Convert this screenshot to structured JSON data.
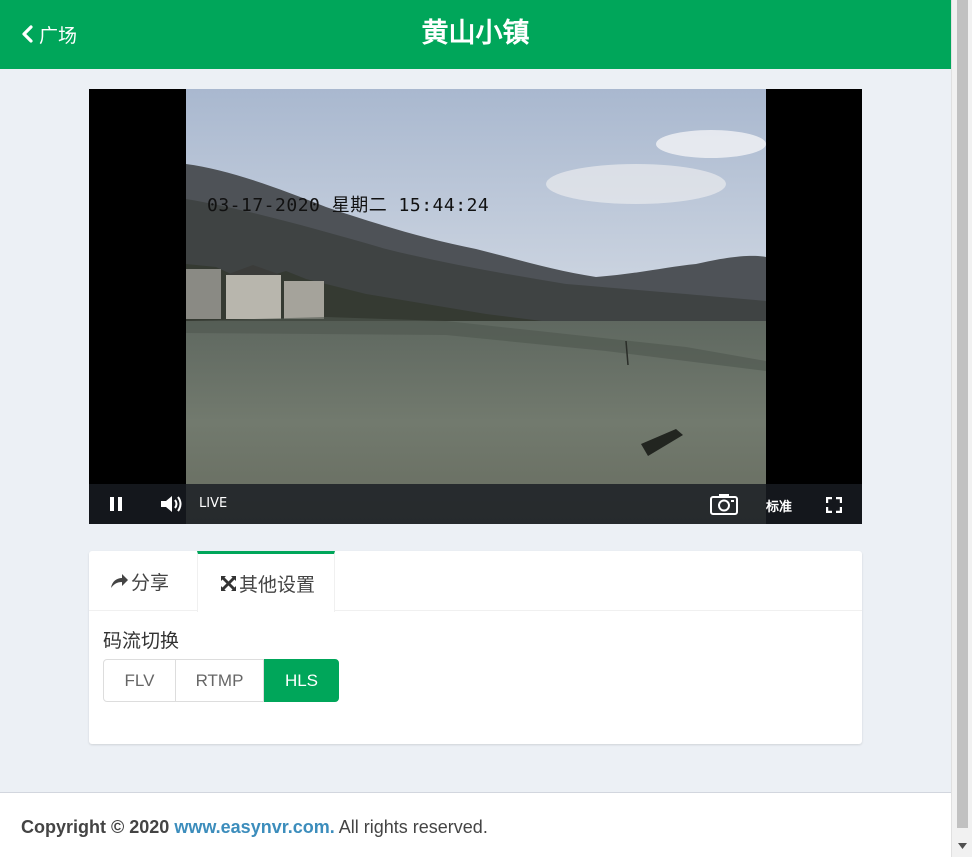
{
  "header": {
    "back_label": "广场",
    "title": "黄山小镇",
    "brand_color": "#00a65a"
  },
  "player": {
    "timestamp": "03-17-2020 星期二 15:44:24",
    "live_label": "LIVE",
    "quality_label": "标准",
    "icons": [
      "pause-icon",
      "volume-icon",
      "camera-icon",
      "fullscreen-icon"
    ]
  },
  "tabs": [
    {
      "label": "分享",
      "icon": "share-icon",
      "active": false
    },
    {
      "label": "其他设置",
      "icon": "settings-expand-icon",
      "active": true
    }
  ],
  "stream": {
    "label": "码流切换",
    "options": [
      "FLV",
      "RTMP",
      "HLS"
    ],
    "selected": "HLS"
  },
  "footer": {
    "prefix": "Copyright © 2020",
    "link": "www.easynvr.com.",
    "suffix": "All rights reserved."
  }
}
